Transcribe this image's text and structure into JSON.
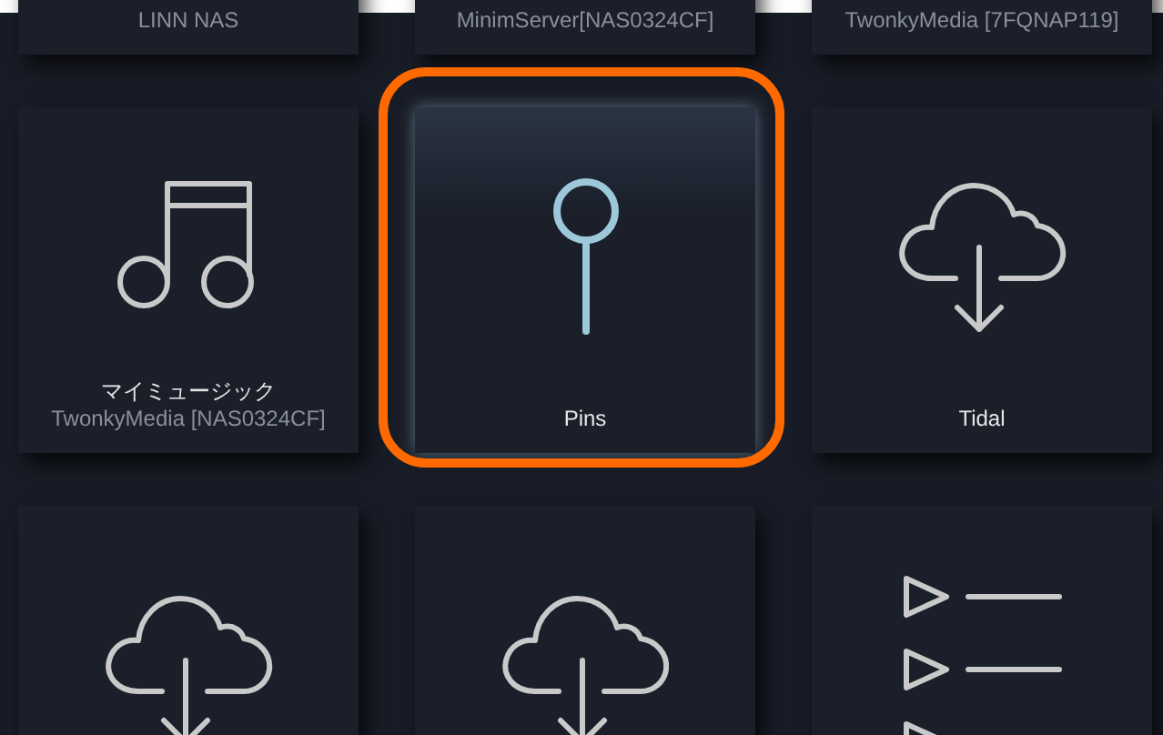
{
  "tiles": [
    {
      "kind": "none",
      "title": "LINN NAS",
      "selected": false
    },
    {
      "kind": "none",
      "title": "MinimServer[NAS0324CF]",
      "selected": false
    },
    {
      "kind": "none",
      "title": "TwonkyMedia [7FQNAP119]",
      "selected": false
    },
    {
      "kind": "music",
      "title": "マイミュージック",
      "subtitle": "TwonkyMedia [NAS0324CF]",
      "selected": false
    },
    {
      "kind": "pin",
      "title": "Pins",
      "selected": true
    },
    {
      "kind": "cloud",
      "title": "Tidal",
      "selected": false
    },
    {
      "kind": "cloud",
      "selected": false
    },
    {
      "kind": "cloud",
      "selected": false
    },
    {
      "kind": "playlist",
      "selected": false
    }
  ]
}
